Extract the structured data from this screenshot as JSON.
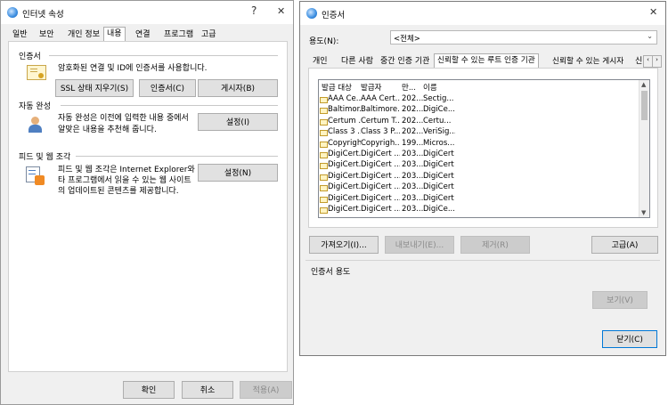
{
  "internet_options": {
    "title": "인터넷 속성",
    "help": "?",
    "close": "✕",
    "tabs": [
      "일반",
      "보안",
      "개인 정보",
      "내용",
      "연결",
      "프로그램",
      "고급"
    ],
    "active_tab": 3,
    "certificates": {
      "heading": "인증서",
      "description": "암호화된 연결 및 ID에 인증서를 사용합니다.",
      "ssl_button": "SSL 상태 지우기(S)",
      "certs_button": "인증서(C)",
      "publishers_button": "게시자(B)"
    },
    "autocomplete": {
      "heading": "자동 완성",
      "line1": "자동 완성은 이전에 입력한 내용 중에서",
      "line2": "알맞은 내용을 추천해 줍니다.",
      "settings_button": "설정(I)"
    },
    "feeds": {
      "heading": "피드 및 웹 조각",
      "line1": "피드 및 웹 조각은 Internet Explorer와 기",
      "line2": "타 프로그램에서 읽을 수 있는 웹 사이트",
      "line3": "의 업데이트된 콘텐츠를 제공합니다.",
      "settings_button": "설정(N)"
    },
    "footer": {
      "ok": "확인",
      "cancel": "취소",
      "apply": "적용(A)"
    }
  },
  "cert_dialog": {
    "title": "인증서",
    "close": "✕",
    "purpose_label": "용도(N):",
    "purpose_value": "<전체>",
    "tabs": [
      "개인",
      "다른 사람",
      "중간 인증 기관",
      "신뢰할 수 있는 루트 인증 기관",
      "신뢰할 수 있는 게시자",
      "신"
    ],
    "active_tab": 3,
    "columns": [
      "발급 대상",
      "발급자",
      "만...",
      "이름"
    ],
    "rows": [
      [
        "AAA Ce...",
        "AAA Cert...",
        "202...",
        "Sectig..."
      ],
      [
        "Baltimor...",
        "Baltimore...",
        "202...",
        "DigiCe..."
      ],
      [
        "Certum ...",
        "Certum T...",
        "202...",
        "Certu..."
      ],
      [
        "Class 3 ...",
        "Class 3 P...",
        "202...",
        "VeriSig..."
      ],
      [
        "Copyrigh...",
        "Copyrigh...",
        "199...",
        "Micros..."
      ],
      [
        "DigiCert...",
        "DigiCert ...",
        "203...",
        "DigiCert"
      ],
      [
        "DigiCert...",
        "DigiCert ...",
        "203...",
        "DigiCert"
      ],
      [
        "DigiCert...",
        "DigiCert ...",
        "203...",
        "DigiCert"
      ],
      [
        "DigiCert...",
        "DigiCert ...",
        "203...",
        "DigiCert"
      ],
      [
        "DigiCert...",
        "DigiCert ...",
        "203...",
        "DigiCert"
      ],
      [
        "DigiCert...",
        "DigiCert ...",
        "203...",
        "DigiCe..."
      ]
    ],
    "import_button": "가져오기(I)...",
    "export_button": "내보내기(E)...",
    "remove_button": "제거(R)",
    "advanced_button": "고급(A)",
    "purposes_label": "인증서 용도",
    "view_button": "보기(V)",
    "close_button": "닫기(C)"
  }
}
